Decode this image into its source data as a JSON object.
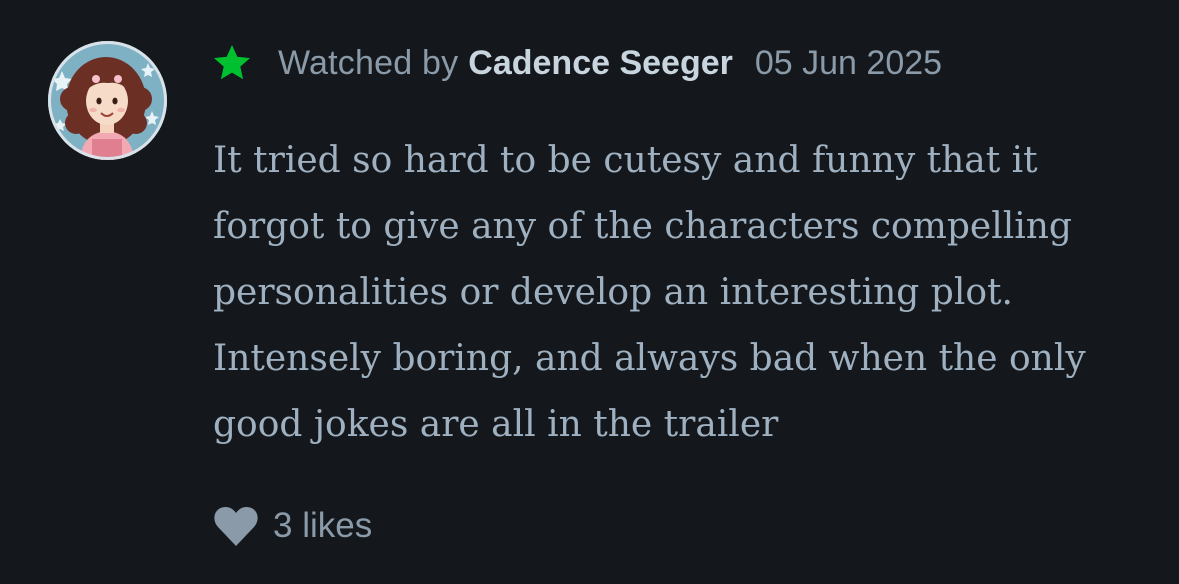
{
  "review": {
    "meta": {
      "prefix": "Watched by",
      "username": "Cadence Seeger",
      "date": "05 Jun 2025",
      "rating_icon": "star-icon",
      "rating_color": "#00c030"
    },
    "body": "It tried so hard to be cutesy and funny that it forgot to give any of the characters compelling personalities or develop an interesting plot. Intensely boring, and always bad when the only good jokes are all in the trailer",
    "likes": {
      "label": "3 likes",
      "icon": "heart-icon"
    },
    "avatar": {
      "icon": "avatar-illustration"
    }
  },
  "colors": {
    "background": "#14181c",
    "muted_text": "#8b9aa8",
    "body_text": "#9fb0c0",
    "username_text": "#c8d4de",
    "star_green": "#00c030",
    "heart_gray": "#8b9aa8"
  }
}
